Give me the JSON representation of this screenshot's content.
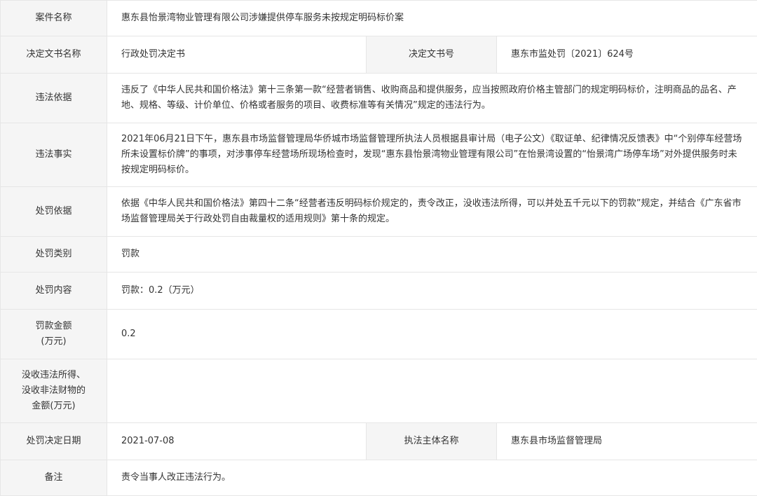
{
  "rows": {
    "case_name": {
      "label": "案件名称",
      "value": "惠东县怡景湾物业管理有限公司涉嫌提供停车服务未按规定明码标价案"
    },
    "decision_doc": {
      "label": "决定文书名称",
      "value": "行政处罚决定书",
      "label2": "决定文书号",
      "value2": "惠东市监处罚〔2021〕624号"
    },
    "violation_basis": {
      "label": "违法依据",
      "value": "违反了《中华人民共和国价格法》第十三条第一款“经营者销售、收购商品和提供服务，应当按照政府价格主管部门的规定明码标价，注明商品的品名、产地、规格、等级、计价单位、价格或者服务的项目、收费标准等有关情况”规定的违法行为。"
    },
    "violation_facts": {
      "label": "违法事实",
      "value": "2021年06月21日下午，惠东县市场监督管理局华侨城市场监督管理所执法人员根据县审计局（电子公文）《取证单、纪律情况反馈表》中“个别停车经营场所未设置标价牌”的事项，对涉事停车经营场所现场检查时，发现“惠东县怡景湾物业管理有限公司”在怡景湾设置的“怡景湾广场停车场”对外提供服务时未按规定明码标价。"
    },
    "penalty_basis": {
      "label": "处罚依据",
      "value": "依据《中华人民共和国价格法》第四十二条“经营者违反明码标价规定的，责令改正，没收违法所得，可以并处五千元以下的罚款”规定，并结合《广东省市场监督管理局关于行政处罚自由裁量权的适用规则》第十条的规定。"
    },
    "penalty_type": {
      "label": "处罚类别",
      "value": "罚款"
    },
    "penalty_content": {
      "label": "处罚内容",
      "value": "罚款：0.2（万元）"
    },
    "fine_amount": {
      "label": "罚款金额",
      "label_sub": "(万元)",
      "value": "0.2"
    },
    "confiscation": {
      "label_line1": "没收违法所得、",
      "label_line2": "没收非法财物的",
      "label_line3": "金额(万元)",
      "value": ""
    },
    "decision_date": {
      "label": "处罚决定日期",
      "value": "2021-07-08",
      "label2": "执法主体名称",
      "value2": "惠东县市场监督管理局"
    },
    "remarks": {
      "label": "备注",
      "value": "责令当事人改正违法行为。"
    }
  }
}
